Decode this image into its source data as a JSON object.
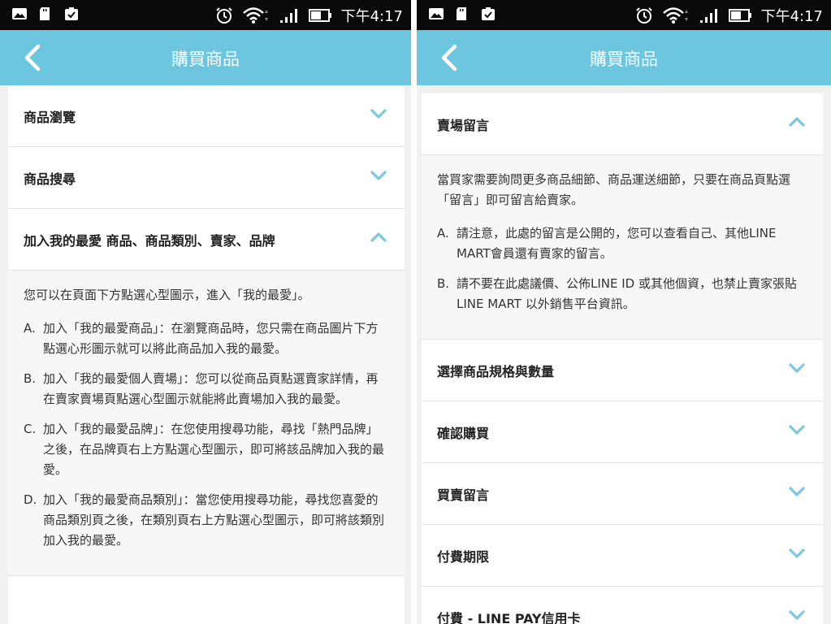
{
  "status_bar": {
    "time": "下午4:17"
  },
  "left": {
    "title": "購買商品",
    "sections": [
      {
        "label": "商品瀏覽",
        "expanded": false
      },
      {
        "label": "商品搜尋",
        "expanded": false
      },
      {
        "label": "加入我的最愛 商品、商品類別、賣家、品牌",
        "expanded": true
      }
    ],
    "expanded_body": {
      "intro": "您可以在頁面下方點選心型圖示，進入「我的最愛」。",
      "items": [
        {
          "letter": "A.",
          "text": "加入「我的最愛商品」：在瀏覽商品時，您只需在商品圖片下方點選心形圖示就可以將此商品加入我的最愛。"
        },
        {
          "letter": "B.",
          "text": "加入「我的最愛個人賣場」：您可以從商品頁點選賣家詳情，再在賣家賣場頁點選心型圖示就能將此賣場加入我的最愛。"
        },
        {
          "letter": "C.",
          "text": "加入「我的最愛品牌」：在您使用搜尋功能，尋找「熱門品牌」之後，在品牌頁右上方點選心型圖示，即可將該品牌加入我的最愛。"
        },
        {
          "letter": "D.",
          "text": "加入「我的最愛商品類別」：當您使用搜尋功能，尋找您喜愛的商品類別頁之後，在類別頁右上方點選心型圖示，即可將該類別加入我的最愛。"
        }
      ]
    }
  },
  "right": {
    "title": "購買商品",
    "expanded_section": {
      "label": "賣場留言",
      "intro": "當買家需要詢問更多商品細節、商品運送細節，只要在商品頁點選「留言」即可留言給賣家。",
      "items": [
        {
          "letter": "A.",
          "text": "請注意，此處的留言是公開的，您可以查看自己、其他LINE MART會員還有賣家的留言。"
        },
        {
          "letter": "B.",
          "text": "請不要在此處議價、公佈LINE ID 或其他個資，也禁止賣家張貼LINE MART 以外銷售平台資訊。"
        }
      ]
    },
    "sections": [
      {
        "label": "選擇商品規格與數量"
      },
      {
        "label": "確認購買"
      },
      {
        "label": "買賣留言"
      },
      {
        "label": "付費期限"
      },
      {
        "label": "付費 - LINE PAY信用卡"
      }
    ]
  },
  "colors": {
    "appbar": "#6cc6e0",
    "chevron": "#7cc8de",
    "statusbar": "#0a0a0a"
  }
}
